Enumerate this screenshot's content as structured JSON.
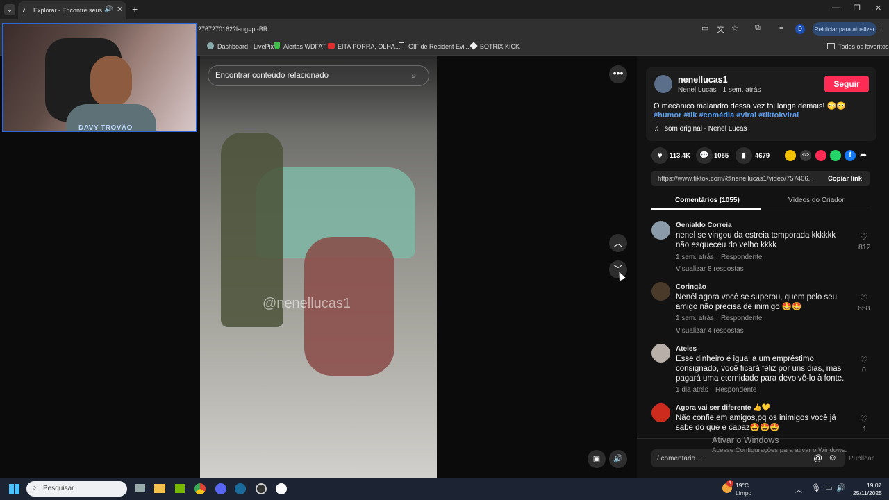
{
  "browser": {
    "tab_title": "Explorar - Encontre seus vi",
    "url": "2767270162?lang=pt-BR",
    "update_button": "Reiniciar para atualizar",
    "profile_letter": "D",
    "bookmarks": [
      "Dashboard - LivePix",
      "Alertas WDFAT",
      "EITA PORRA, OLHA...",
      "GIF de Resident Evil...",
      "BOTRIX KICK"
    ],
    "favorites_label": "Todos os favoritos"
  },
  "webcam": {
    "name_label": "DAVY TROVÃO"
  },
  "video": {
    "search_placeholder": "Encontrar conteúdo relacionado",
    "watermark": "@nenellucas1"
  },
  "post": {
    "username": "nenellucas1",
    "subline": "Nenel Lucas · 1 sem. atrás",
    "follow_label": "Seguir",
    "caption": "O mecânico malandro dessa vez foi longe demais! 😳😳",
    "hashtags": [
      "#humor",
      "#tik",
      "#comédia",
      "#viral",
      "#tiktokviral"
    ],
    "sound": "som original - Nenel Lucas",
    "likes": "113.4K",
    "comments": "1055",
    "saves": "4679",
    "link": "https://www.tiktok.com/@nenellucas1/video/757406...",
    "copy_link_label": "Copiar link"
  },
  "tabs": {
    "comments": "Comentários (1055)",
    "creator": "Vídeos do Criador"
  },
  "comments": [
    {
      "name": "Genialdo Correia",
      "text": "nenel se vingou da estreia temporada kkkkkk não esqueceu do velho kkkk",
      "time": "1 sem. atrás",
      "reply": "Respondente",
      "replies": "Visualizar 8 respostas",
      "likes": "812"
    },
    {
      "name": "Coringão",
      "text": "Nenél agora você se superou, quem pelo seu amigo não precisa de inimigo 🤩🤩",
      "time": "1 sem. atrás",
      "reply": "Respondente",
      "replies": "Visualizar 4 respostas",
      "likes": "658"
    },
    {
      "name": "Ateles",
      "text": "Esse dinheiro é igual a um empréstimo consignado, você ficará feliz por uns dias, mas pagará uma eternidade para devolvê-lo à fonte.",
      "time": "1 dia atrás",
      "reply": "Respondente",
      "replies": "",
      "likes": "0"
    },
    {
      "name": "Agora vai ser diferente 👍💛",
      "text": "Não confie em amigos,pq os inimigos você já sabe do que é capaz🤩🤩🤩",
      "time": "",
      "reply": "",
      "replies": "",
      "likes": "1"
    }
  ],
  "comment_input": {
    "placeholder": "/ comentário...",
    "publish": "Publicar"
  },
  "watermark": {
    "line1": "Ativar o Windows",
    "line2": "Acesse Configurações para ativar o Windows."
  },
  "taskbar": {
    "search": "Pesquisar",
    "weather_temp": "19°C",
    "weather_desc": "Limpo",
    "badge": "4",
    "time": "19:07",
    "date": "25/11/2025"
  }
}
